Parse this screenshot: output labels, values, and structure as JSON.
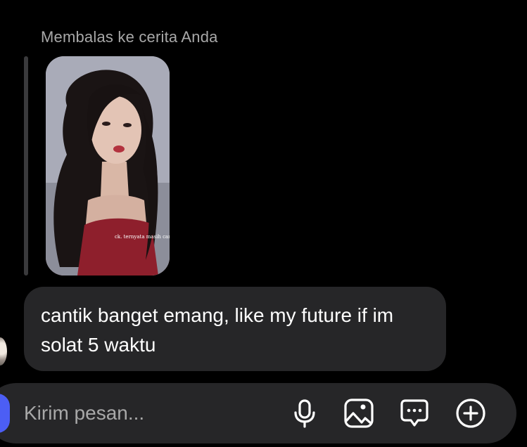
{
  "reply": {
    "label": "Membalas ke cerita Anda",
    "story_caption": "ck. ternyata masih cantik"
  },
  "message": {
    "text": "cantik banget emang, like my future if im solat 5 waktu"
  },
  "composer": {
    "placeholder": "Kirim pesan...",
    "icons": [
      "microphone-icon",
      "image-icon",
      "sticker-chat-icon",
      "plus-circle-icon"
    ]
  },
  "colors": {
    "background": "#000000",
    "bubble": "#262628",
    "secondary_text": "#a8a8a8",
    "accent": "#4c5ef5"
  }
}
